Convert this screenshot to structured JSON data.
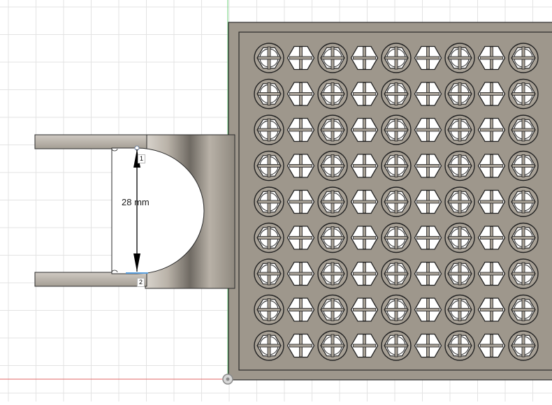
{
  "canvas": {
    "background": "#ffffff",
    "grid_color": "#e3e3e3",
    "axis_x_color": "#e06666",
    "axis_y_color": "#6bd07a"
  },
  "model": {
    "plate_color": "#9e978c",
    "plate_border": "#2a2a2a",
    "hole_grid": {
      "rows": 9,
      "cols": 9
    }
  },
  "dimension": {
    "value_label": "28 mm",
    "point_labels": [
      "1",
      "2"
    ],
    "line_color": "#000000"
  }
}
